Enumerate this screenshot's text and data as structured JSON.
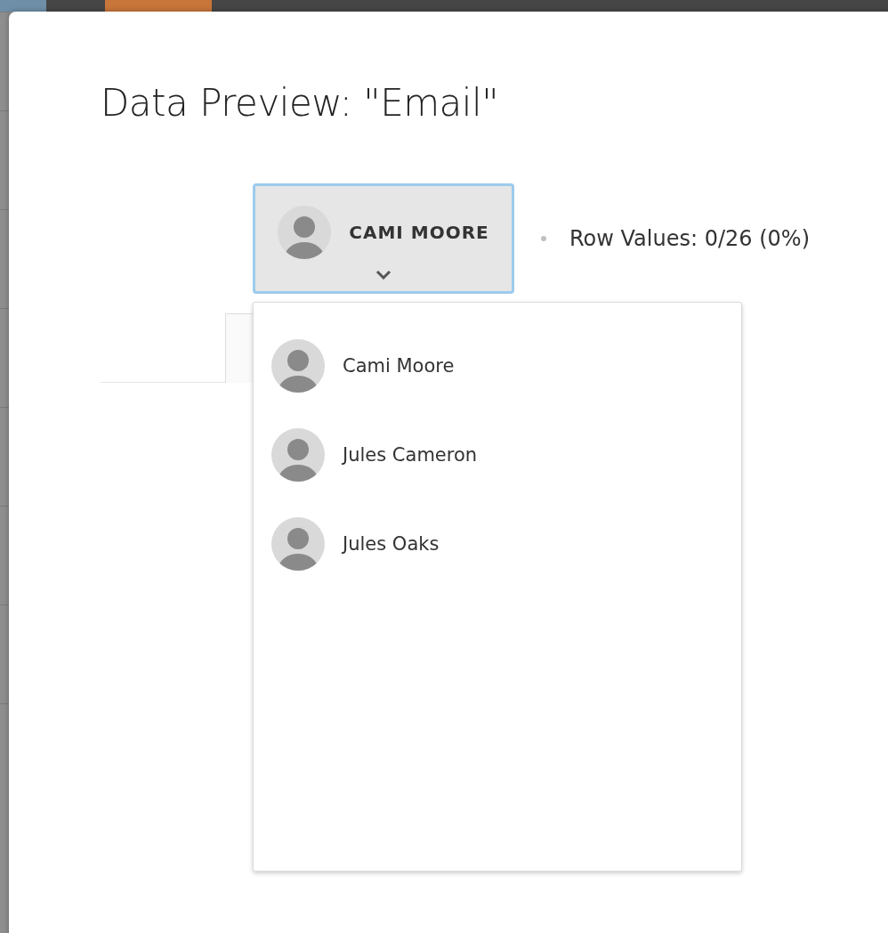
{
  "dialog": {
    "title": "Data Preview: \"Email\"",
    "user_button": {
      "name": "CAMI MOORE",
      "expanded": true
    },
    "row_values": "Row Values: 0/26 (0%)",
    "menu": {
      "items": [
        {
          "name": "Cami Moore"
        },
        {
          "name": "Jules Cameron"
        },
        {
          "name": "Jules Oaks"
        }
      ]
    }
  }
}
